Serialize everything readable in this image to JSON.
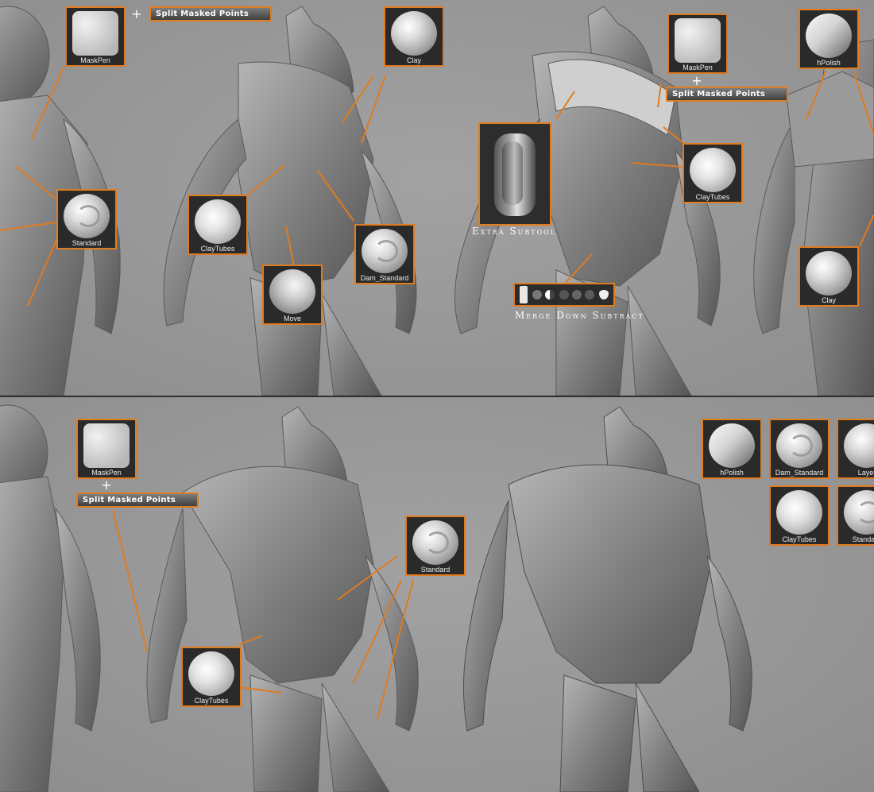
{
  "top_panel": {
    "brushes": [
      {
        "id": "maskpen-1",
        "label": "MaskPen",
        "style": "mask"
      },
      {
        "id": "standard-1",
        "label": "Standard",
        "style": "swirl"
      },
      {
        "id": "claytubes-1",
        "label": "ClayTubes",
        "style": "tube"
      },
      {
        "id": "move-1",
        "label": "Move",
        "style": "move"
      },
      {
        "id": "clay-1",
        "label": "Clay",
        "style": "clay"
      },
      {
        "id": "damstandard-1",
        "label": "Dam_Standard",
        "style": "swirl"
      },
      {
        "id": "maskpen-2",
        "label": "MaskPen",
        "style": "mask"
      },
      {
        "id": "claytubes-2",
        "label": "ClayTubes",
        "style": "tube"
      },
      {
        "id": "hpolish-1",
        "label": "hPolish",
        "style": "polish"
      },
      {
        "id": "clay-2",
        "label": "Clay",
        "style": "clay"
      }
    ],
    "split_buttons": [
      "Split Masked Points",
      "Split Masked Points"
    ],
    "captions": {
      "extra_subtool": "Extra Subtool",
      "merge_down": "Merge Down Subtract"
    }
  },
  "bottom_panel": {
    "brushes": [
      {
        "id": "maskpen-3",
        "label": "MaskPen",
        "style": "mask"
      },
      {
        "id": "claytubes-3",
        "label": "ClayTubes",
        "style": "tube"
      },
      {
        "id": "standard-2",
        "label": "Standard",
        "style": "swirl"
      },
      {
        "id": "hpolish-2",
        "label": "hPolish",
        "style": "polish"
      },
      {
        "id": "damstandard-2",
        "label": "Dam_Standard",
        "style": "swirl"
      },
      {
        "id": "layer-1",
        "label": "Layer",
        "style": "clay"
      },
      {
        "id": "claytubes-4",
        "label": "ClayTubes",
        "style": "tube"
      },
      {
        "id": "standard-3",
        "label": "Standard",
        "style": "swirl"
      }
    ],
    "split_buttons": [
      "Split Masked Points"
    ]
  },
  "colors": {
    "accent": "#e07b20",
    "background": "#979797",
    "tile": "#2a2a2a"
  }
}
